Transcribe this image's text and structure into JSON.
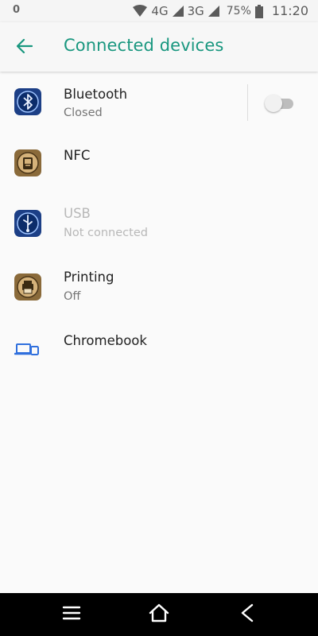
{
  "status_bar": {
    "left_indicator": "0",
    "network_1": "4G",
    "network_2": "3G",
    "battery": "75%",
    "time": "11:20",
    "icons": [
      "wifi-icon",
      "signal-icon",
      "signal-icon",
      "battery-icon"
    ]
  },
  "header": {
    "title": "Connected devices",
    "back_icon": "arrow-left-icon",
    "accent_color": "#19977f"
  },
  "items": [
    {
      "title": "Bluetooth",
      "subtitle": "Closed",
      "icon": "bluetooth-icon",
      "toggle_on": false,
      "enabled": true
    },
    {
      "title": "NFC",
      "subtitle": "",
      "icon": "nfc-icon",
      "enabled": true
    },
    {
      "title": "USB",
      "subtitle": "Not connected",
      "icon": "usb-icon",
      "enabled": false
    },
    {
      "title": "Printing",
      "subtitle": "Off",
      "icon": "printer-icon",
      "enabled": true
    },
    {
      "title": "Chromebook",
      "subtitle": "",
      "icon": "devices-icon",
      "enabled": true
    }
  ],
  "nav_bar": {
    "icons": [
      "menu-icon",
      "home-icon",
      "back-icon"
    ]
  }
}
